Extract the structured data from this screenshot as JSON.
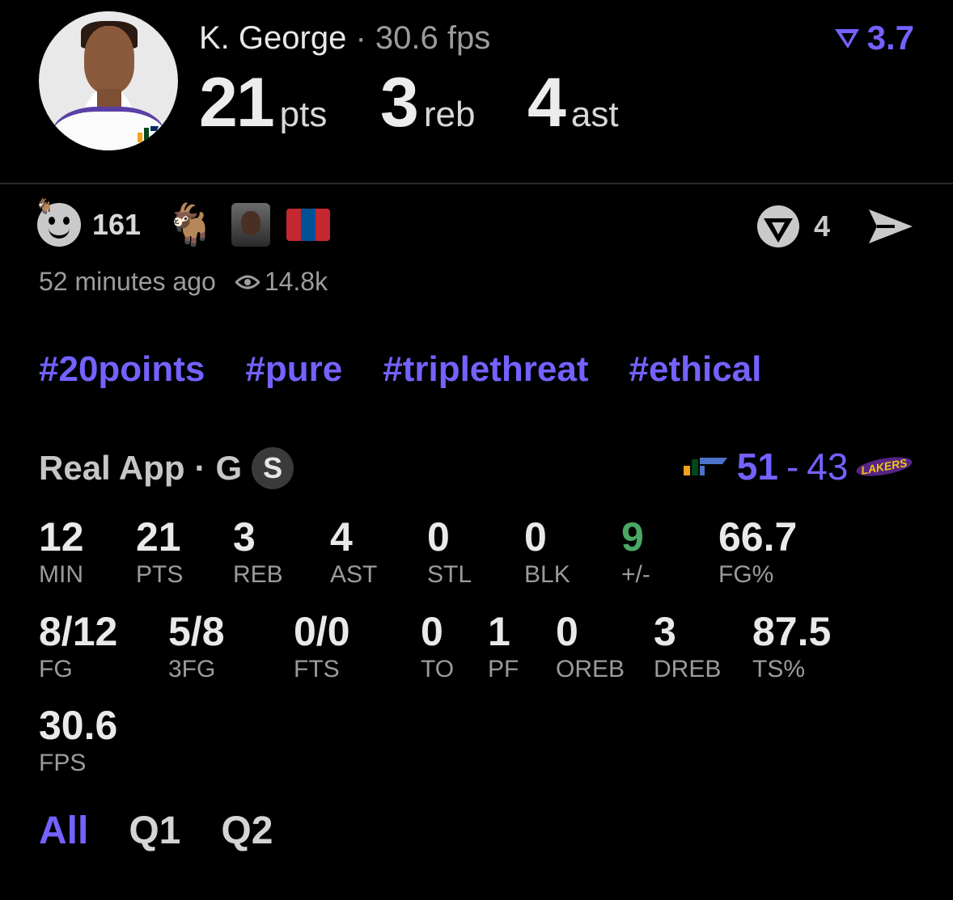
{
  "player": {
    "name": "K. George",
    "separator": "·",
    "fps_text": "30.6 fps",
    "rating": "3.7",
    "summary": [
      {
        "value": "21",
        "unit": "pts"
      },
      {
        "value": "3",
        "unit": "reb"
      },
      {
        "value": "4",
        "unit": "ast"
      }
    ]
  },
  "reactions": {
    "reaction_count": "161",
    "goat_emoji": "🐐",
    "share_count": "4",
    "flag_colors": [
      "#c4272f",
      "#015197",
      "#c4272f"
    ]
  },
  "meta": {
    "time_ago": "52 minutes ago",
    "views": "14.8k"
  },
  "hashtags": [
    "#20points",
    "#pure",
    "#triplethreat",
    "#ethical"
  ],
  "game": {
    "source": "Real App",
    "separator": "·",
    "position": "G",
    "badge": "S",
    "score_home": "51",
    "score_dash": "-",
    "score_away": "43",
    "lakers_text": "LAKERS"
  },
  "stats_row1": [
    {
      "value": "12",
      "label": "MIN"
    },
    {
      "value": "21",
      "label": "PTS"
    },
    {
      "value": "3",
      "label": "REB"
    },
    {
      "value": "4",
      "label": "AST"
    },
    {
      "value": "0",
      "label": "STL"
    },
    {
      "value": "0",
      "label": "BLK"
    },
    {
      "value": "9",
      "label": "+/-"
    },
    {
      "value": "66.7",
      "label": "FG%"
    }
  ],
  "stats_row2": [
    {
      "value": "8/12",
      "label": "FG"
    },
    {
      "value": "5/8",
      "label": "3FG"
    },
    {
      "value": "0/0",
      "label": "FTS"
    },
    {
      "value": "0",
      "label": "TO"
    },
    {
      "value": "1",
      "label": "PF"
    },
    {
      "value": "0",
      "label": "OREB"
    },
    {
      "value": "3",
      "label": "DREB"
    },
    {
      "value": "87.5",
      "label": "TS%"
    }
  ],
  "stats_row3": [
    {
      "value": "30.6",
      "label": "FPS"
    }
  ],
  "periods": [
    "All",
    "Q1",
    "Q2"
  ],
  "colors": {
    "accent": "#7462ff",
    "positive": "#4aa865",
    "background": "#000000"
  }
}
